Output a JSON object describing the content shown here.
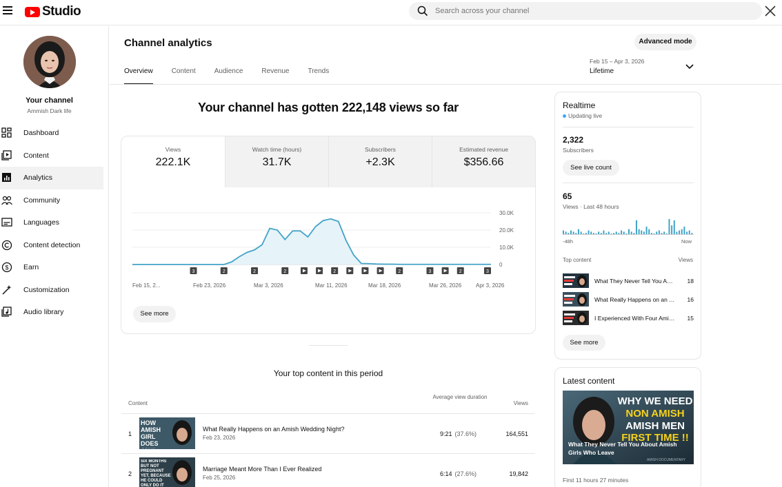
{
  "app": {
    "logo_text": "Studio"
  },
  "search": {
    "placeholder": "Search across your channel"
  },
  "channel": {
    "title": "Your channel",
    "name": "Ammish Dark life"
  },
  "nav": [
    {
      "label": "Dashboard",
      "icon": "dashboard-icon",
      "active": false
    },
    {
      "label": "Content",
      "icon": "content-icon",
      "active": false
    },
    {
      "label": "Analytics",
      "icon": "analytics-icon",
      "active": true
    },
    {
      "label": "Community",
      "icon": "community-icon",
      "active": false
    },
    {
      "label": "Languages",
      "icon": "languages-icon",
      "active": false
    },
    {
      "label": "Content detection",
      "icon": "copyright-icon",
      "active": false
    },
    {
      "label": "Earn",
      "icon": "dollar-icon",
      "active": false
    },
    {
      "label": "Customization",
      "icon": "magic-wand-icon",
      "active": false
    },
    {
      "label": "Audio library",
      "icon": "audio-library-icon",
      "active": false
    }
  ],
  "header": {
    "title": "Channel analytics",
    "advanced_mode": "Advanced mode",
    "tabs": [
      "Overview",
      "Content",
      "Audience",
      "Revenue",
      "Trends"
    ],
    "active_tab": "Overview",
    "date_range": "Feb 15 – Apr 3, 2026",
    "date_label": "Lifetime"
  },
  "headline": "Your channel has gotten 222,148 views so far",
  "metrics": [
    {
      "label": "Views",
      "value": "222.1K"
    },
    {
      "label": "Watch time (hours)",
      "value": "31.7K"
    },
    {
      "label": "Subscribers",
      "value": "+2.3K"
    },
    {
      "label": "Estimated revenue",
      "value": "$356.66"
    }
  ],
  "chart_data": {
    "type": "area",
    "series_color": "#41a3c7",
    "x_labels": [
      "Feb 15, 2...",
      "Feb 23, 2026",
      "Mar 3, 2026",
      "Mar 11, 2026",
      "Mar 18, 2026",
      "Mar 26, 2026",
      "Apr 3, 2026"
    ],
    "y_ticks": [
      "30.0K",
      "20.0K",
      "10.0K",
      "0"
    ],
    "ylim": [
      0,
      30000
    ],
    "day_index_max": 47,
    "values": [
      0,
      0,
      0,
      0,
      0,
      0,
      0,
      0,
      0,
      0,
      0,
      0,
      0,
      1500,
      4500,
      7000,
      8500,
      11500,
      21000,
      20000,
      14500,
      19500,
      19500,
      16000,
      22000,
      25500,
      26500,
      25000,
      14000,
      5500,
      600,
      500,
      300,
      200,
      200,
      100,
      100,
      100,
      100,
      100,
      100,
      100,
      100,
      100,
      100,
      100,
      100,
      100
    ],
    "markers": [
      {
        "day": 8,
        "kind": "count",
        "label": "3"
      },
      {
        "day": 12,
        "kind": "count",
        "label": "2"
      },
      {
        "day": 16,
        "kind": "count",
        "label": "2"
      },
      {
        "day": 20,
        "kind": "count",
        "label": "2"
      },
      {
        "day": 22.5,
        "kind": "video",
        "label": ""
      },
      {
        "day": 24.5,
        "kind": "video",
        "label": ""
      },
      {
        "day": 26.5,
        "kind": "count",
        "label": "2"
      },
      {
        "day": 28.5,
        "kind": "video",
        "label": ""
      },
      {
        "day": 30.5,
        "kind": "video",
        "label": ""
      },
      {
        "day": 32.5,
        "kind": "video",
        "label": ""
      },
      {
        "day": 35,
        "kind": "count",
        "label": "2"
      },
      {
        "day": 39,
        "kind": "count",
        "label": "3"
      },
      {
        "day": 41,
        "kind": "video",
        "label": ""
      },
      {
        "day": 43,
        "kind": "count",
        "label": "2"
      },
      {
        "day": 51.5,
        "kind": "count",
        "label": "3"
      }
    ]
  },
  "chart_see_more": "See more",
  "top_content": {
    "title": "Your top content in this period",
    "col_content": "Content",
    "col_avg": "Average view duration",
    "col_views": "Views",
    "rows": [
      {
        "rank": "1",
        "title": "What Really Happens on an Amish Wedding Night?",
        "date": "Feb 23, 2026",
        "duration": "9:21",
        "pct": "(37.6%)",
        "views": "164,551",
        "thumb_text": "HOW AMISH GIRL DOES AN#L"
      },
      {
        "rank": "2",
        "title": "Marriage Meant More Than I Ever Realized",
        "date": "Feb 25, 2026",
        "duration": "6:14",
        "pct": "(27.6%)",
        "views": "19,842",
        "thumb_text": "SIX MONTHS BUT NOT PREGNANT YET, BECAUSE HE COULD ONLY DO IT SIDE !!"
      }
    ]
  },
  "realtime": {
    "title": "Realtime",
    "status": "Updating live",
    "subs_value": "2,322",
    "subs_label": "Subscribers",
    "live_count_btn": "See live count",
    "views_value": "65",
    "views_label": "Views · Last 48 hours",
    "axis_left": "-48h",
    "axis_right": "Now",
    "bars": [
      3,
      2,
      1,
      3,
      2,
      1,
      4,
      2,
      0,
      1,
      3,
      2,
      1,
      0,
      2,
      1,
      3,
      1,
      2,
      0,
      1,
      2,
      1,
      3,
      2,
      0,
      4,
      2,
      1,
      11,
      4,
      3,
      2,
      6,
      4,
      1,
      0,
      2,
      3,
      1,
      2,
      0,
      12,
      7,
      11,
      2,
      3,
      4,
      6,
      2,
      3,
      1
    ],
    "top_header": "Top content",
    "top_views_header": "Views",
    "top": [
      {
        "title": "What They Never Tell You About Amish Girls Who Leave",
        "views": "18"
      },
      {
        "title": "What Really Happens on an Amish Wedding Night?",
        "views": "16"
      },
      {
        "title": "I Experienced With Four Amish Men",
        "views": "15"
      }
    ],
    "see_more": "See more"
  },
  "latest": {
    "title": "Latest content",
    "thumb_line1": "WHY WE NEED",
    "thumb_line2": "NON AMISH",
    "thumb_line3": "AMISH MEN",
    "thumb_line4": "FIRST TIME !!",
    "thumb_caption": "What They Never Tell You About Amish Girls Who Leave",
    "thumb_tag": "AMISH DOCUMENTARY",
    "meta": "First 11 hours 27 minutes"
  }
}
